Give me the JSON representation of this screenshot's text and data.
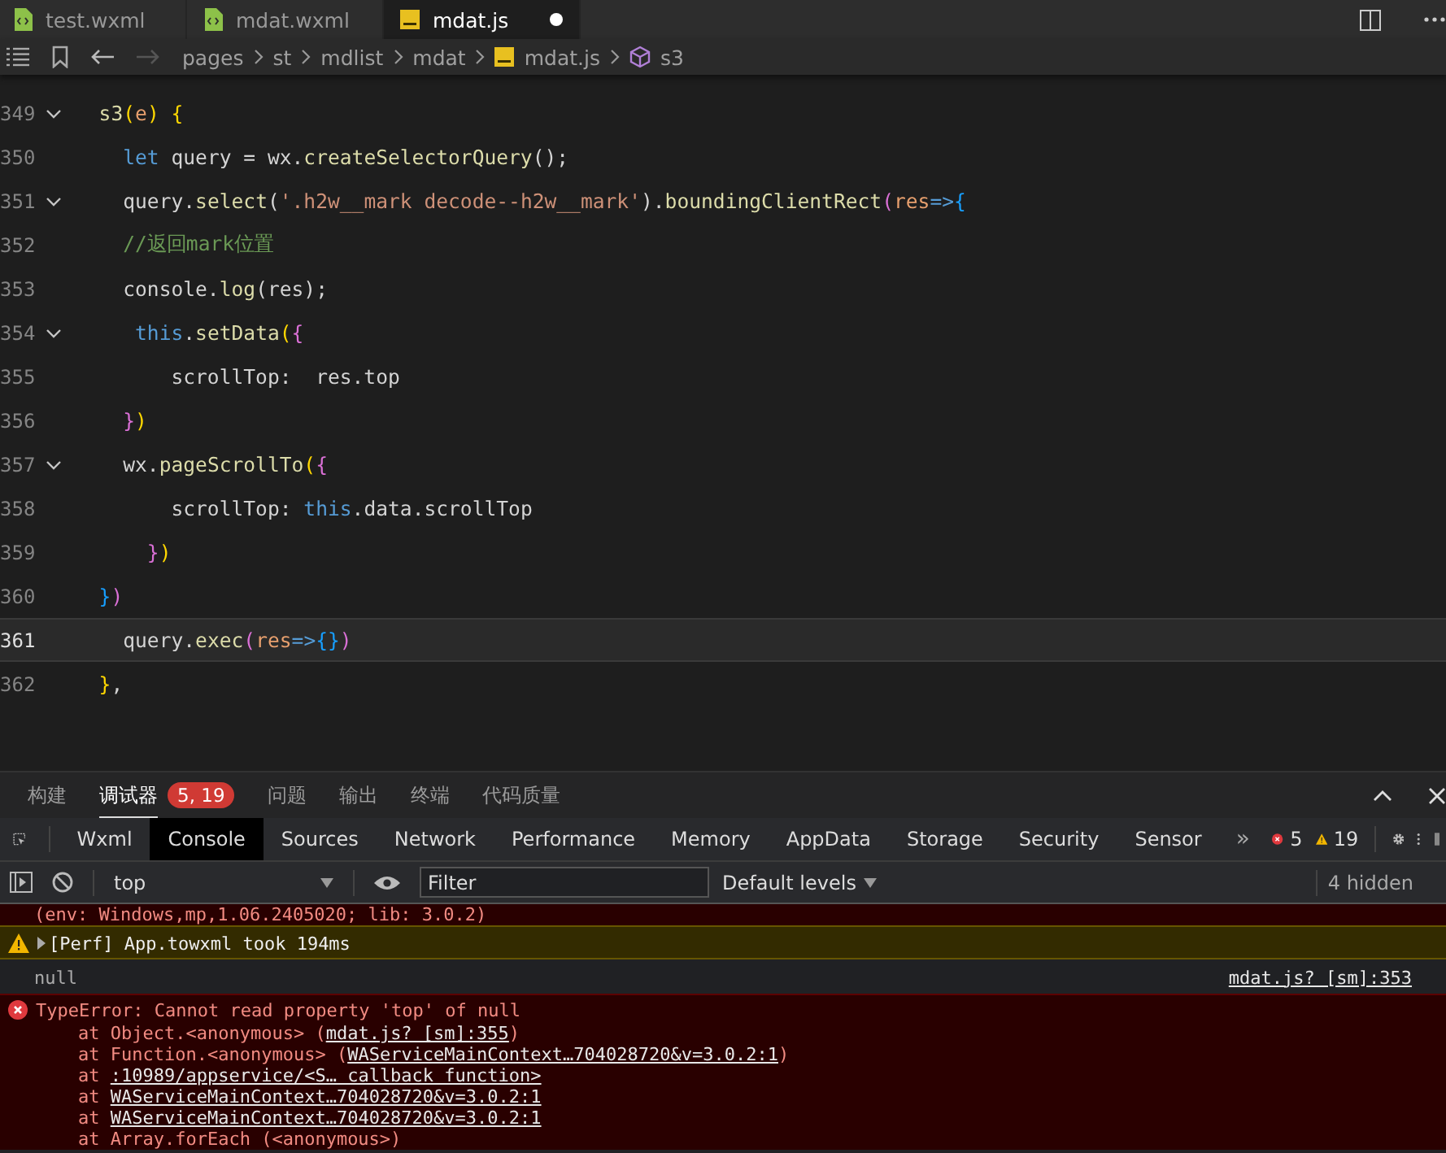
{
  "tabs": [
    {
      "label": "test.wxml",
      "kind": "wxml",
      "selected": false,
      "modified": false
    },
    {
      "label": "mdat.wxml",
      "kind": "wxml",
      "selected": false,
      "modified": false
    },
    {
      "label": "mdat.js",
      "kind": "js",
      "selected": true,
      "modified": true
    }
  ],
  "breadcrumb": [
    {
      "label": "pages",
      "kind": "folder"
    },
    {
      "label": "st",
      "kind": "folder"
    },
    {
      "label": "mdlist",
      "kind": "folder"
    },
    {
      "label": "mdat",
      "kind": "folder"
    },
    {
      "label": "mdat.js",
      "kind": "js"
    },
    {
      "label": "s3",
      "kind": "symbol"
    }
  ],
  "code_lines": [
    {
      "number": "349",
      "foldable": true,
      "current": false,
      "tokens": [
        {
          "kind": "fn",
          "text": "  s3"
        },
        {
          "kind": "b1",
          "text": "("
        },
        {
          "kind": "param",
          "text": "e"
        },
        {
          "kind": "b1",
          "text": ") "
        },
        {
          "kind": "b1",
          "text": "{"
        }
      ]
    },
    {
      "number": "350",
      "foldable": false,
      "current": false,
      "tokens": [
        {
          "kind": "kw",
          "text": "    let"
        },
        {
          "kind": "text",
          "text": " query = wx."
        },
        {
          "kind": "fn",
          "text": "createSelectorQuery"
        },
        {
          "kind": "text",
          "text": "();"
        }
      ]
    },
    {
      "number": "351",
      "foldable": true,
      "current": false,
      "tokens": [
        {
          "kind": "text",
          "text": "    query."
        },
        {
          "kind": "fn",
          "text": "select"
        },
        {
          "kind": "text",
          "text": "("
        },
        {
          "kind": "str",
          "text": "'.h2w__mark decode--h2w__mark'"
        },
        {
          "kind": "text",
          "text": ")."
        },
        {
          "kind": "fn",
          "text": "boundingClientRect"
        },
        {
          "kind": "b2",
          "text": "("
        },
        {
          "kind": "param",
          "text": "res"
        },
        {
          "kind": "kw",
          "text": "=>"
        },
        {
          "kind": "b3",
          "text": "{"
        }
      ]
    },
    {
      "number": "352",
      "foldable": false,
      "current": false,
      "tokens": [
        {
          "kind": "cmt",
          "text": "    //返回mark位置"
        }
      ]
    },
    {
      "number": "353",
      "foldable": false,
      "current": false,
      "tokens": [
        {
          "kind": "text",
          "text": "    console."
        },
        {
          "kind": "fn",
          "text": "log"
        },
        {
          "kind": "text",
          "text": "(res);"
        }
      ]
    },
    {
      "number": "354",
      "foldable": true,
      "current": false,
      "tokens": [
        {
          "kind": "kw",
          "text": "     this"
        },
        {
          "kind": "text",
          "text": "."
        },
        {
          "kind": "fn",
          "text": "setData"
        },
        {
          "kind": "b1",
          "text": "("
        },
        {
          "kind": "b2",
          "text": "{"
        }
      ]
    },
    {
      "number": "355",
      "foldable": false,
      "current": false,
      "tokens": [
        {
          "kind": "text",
          "text": "        scrollTop:  res.top"
        }
      ]
    },
    {
      "number": "356",
      "foldable": false,
      "current": false,
      "tokens": [
        {
          "kind": "b2",
          "text": "    }"
        },
        {
          "kind": "b1",
          "text": ")"
        }
      ]
    },
    {
      "number": "357",
      "foldable": true,
      "current": false,
      "tokens": [
        {
          "kind": "text",
          "text": "    wx."
        },
        {
          "kind": "fn",
          "text": "pageScrollTo"
        },
        {
          "kind": "b1",
          "text": "("
        },
        {
          "kind": "b2",
          "text": "{"
        }
      ]
    },
    {
      "number": "358",
      "foldable": false,
      "current": false,
      "tokens": [
        {
          "kind": "text",
          "text": "        scrollTop: "
        },
        {
          "kind": "kw",
          "text": "this"
        },
        {
          "kind": "text",
          "text": ".data.scrollTop"
        }
      ]
    },
    {
      "number": "359",
      "foldable": false,
      "current": false,
      "tokens": [
        {
          "kind": "b2",
          "text": "      }"
        },
        {
          "kind": "b1",
          "text": ")"
        }
      ]
    },
    {
      "number": "360",
      "foldable": false,
      "current": false,
      "tokens": [
        {
          "kind": "b3",
          "text": "  }"
        },
        {
          "kind": "b2",
          "text": ")"
        }
      ]
    },
    {
      "number": "361",
      "foldable": false,
      "current": true,
      "tokens": [
        {
          "kind": "text",
          "text": "    query."
        },
        {
          "kind": "fn",
          "text": "exec"
        },
        {
          "kind": "b2",
          "text": "("
        },
        {
          "kind": "param",
          "text": "res"
        },
        {
          "kind": "kw",
          "text": "=>"
        },
        {
          "kind": "b3",
          "text": "{}"
        },
        {
          "kind": "b2",
          "text": ")"
        }
      ]
    },
    {
      "number": "362",
      "foldable": false,
      "current": false,
      "tokens": [
        {
          "kind": "b1",
          "text": "  }"
        },
        {
          "kind": "text",
          "text": ","
        }
      ]
    }
  ],
  "panel_tabs": [
    {
      "label": "构建",
      "selected": false
    },
    {
      "label": "调试器",
      "selected": true,
      "badge": "5, 19"
    },
    {
      "label": "问题",
      "selected": false
    },
    {
      "label": "输出",
      "selected": false
    },
    {
      "label": "终端",
      "selected": false
    },
    {
      "label": "代码质量",
      "selected": false
    }
  ],
  "devtools_tabs": [
    {
      "label": "Wxml",
      "selected": false
    },
    {
      "label": "Console",
      "selected": true
    },
    {
      "label": "Sources",
      "selected": false
    },
    {
      "label": "Network",
      "selected": false
    },
    {
      "label": "Performance",
      "selected": false
    },
    {
      "label": "Memory",
      "selected": false
    },
    {
      "label": "AppData",
      "selected": false
    },
    {
      "label": "Storage",
      "selected": false
    },
    {
      "label": "Security",
      "selected": false
    },
    {
      "label": "Sensor",
      "selected": false
    }
  ],
  "more_tabs": "»",
  "error_count": "5",
  "warning_count": "19",
  "console_toolbar": {
    "context": "top",
    "filter_placeholder": "Filter",
    "levels": "Default levels",
    "hidden": "4 hidden"
  },
  "messages": [
    {
      "kind": "error_tail",
      "text": "(env: Windows,mp,1.06.2405020; lib: 3.0.2)"
    },
    {
      "kind": "warning",
      "text": "[Perf] App.towxml took 194ms"
    },
    {
      "kind": "log",
      "text": "null",
      "source": "mdat.js? [sm]:353"
    },
    {
      "kind": "error",
      "text": "TypeError: Cannot read property 'top' of null",
      "stack": [
        {
          "prefix": "at Object.<anonymous> (",
          "link": "mdat.js? [sm]:355",
          "suffix": ")"
        },
        {
          "prefix": "at Function.<anonymous> (",
          "link": "WAServiceMainContext…704028720&v=3.0.2:1",
          "suffix": ")"
        },
        {
          "prefix": "at ",
          "link": ":10989/appservice/<S… callback function>"
        },
        {
          "prefix": "at ",
          "link": "WAServiceMainContext…704028720&v=3.0.2:1"
        },
        {
          "prefix": "at ",
          "link": "WAServiceMainContext…704028720&v=3.0.2:1"
        },
        {
          "prefix": "at Array.forEach (<anonymous>)"
        }
      ]
    }
  ]
}
